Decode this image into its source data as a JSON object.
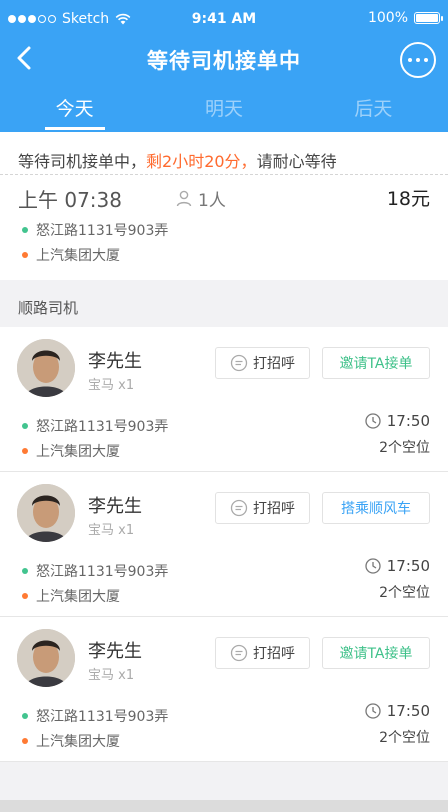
{
  "status_bar": {
    "carrier": "Sketch",
    "time": "9:41 AM",
    "battery": "100%"
  },
  "nav": {
    "title": "等待司机接单中"
  },
  "tabs": [
    {
      "label": "今天"
    },
    {
      "label": "明天"
    },
    {
      "label": "后天"
    }
  ],
  "order": {
    "wait_prefix": "等待司机接单中，",
    "wait_highlight": "剩2小时20分，",
    "wait_suffix": "请耐心等待",
    "time": "上午 07:38",
    "people": "1人",
    "price": "18元",
    "from": "怒江路1131号903弄",
    "to": "上汽集团大厦"
  },
  "section": {
    "title": "顺路司机"
  },
  "drivers": [
    {
      "name": "李先生",
      "car": "宝马 x1",
      "greet": "打招呼",
      "action": "邀请TA接单",
      "from": "怒江路1131号903弄",
      "to": "上汽集团大厦",
      "time": "17:50",
      "seats": "2个空位"
    },
    {
      "name": "李先生",
      "car": "宝马 x1",
      "greet": "打招呼",
      "action": "搭乘顺风车",
      "from": "怒江路1131号903弄",
      "to": "上汽集团大厦",
      "time": "17:50",
      "seats": "2个空位"
    },
    {
      "name": "李先生",
      "car": "宝马 x1",
      "greet": "打招呼",
      "action": "邀请TA接单",
      "from": "怒江路1131号903弄",
      "to": "上汽集团大厦",
      "time": "17:50",
      "seats": "2个空位"
    }
  ],
  "colors": {
    "primary": "#3aa3f5",
    "highlight": "#ff6a2e",
    "green": "#3fc18a",
    "origin_dot": "#42c48f",
    "dest_dot": "#ff7a33"
  }
}
